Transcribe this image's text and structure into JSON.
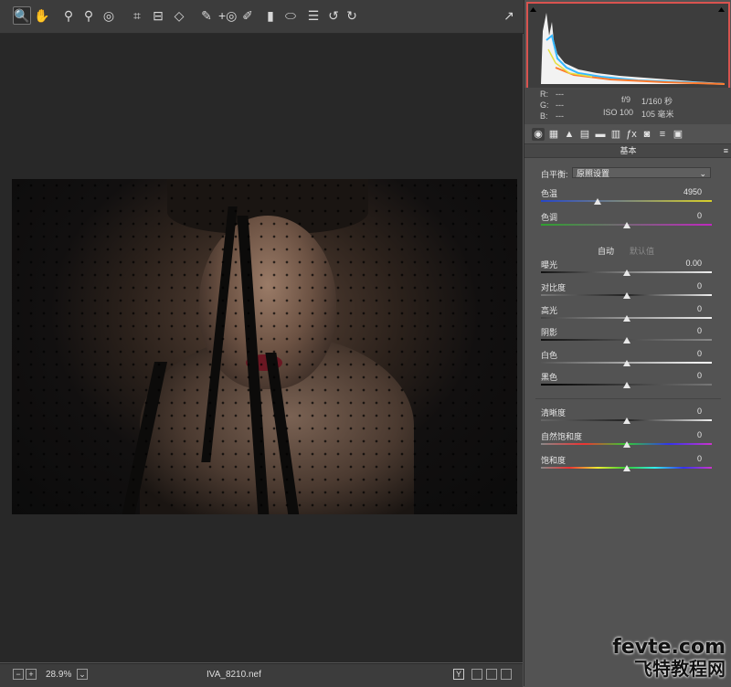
{
  "toolbar": {
    "tools": [
      {
        "icon": "zoom-icon",
        "glyph": "🔍"
      },
      {
        "icon": "hand-icon",
        "glyph": "✋"
      },
      {
        "icon": "white-balance-icon",
        "glyph": "⚲"
      },
      {
        "icon": "color-sampler-icon",
        "glyph": "⚲"
      },
      {
        "icon": "targeted-adjust-icon",
        "glyph": "◎"
      },
      {
        "icon": "crop-icon",
        "glyph": "⌗"
      },
      {
        "icon": "straighten-icon",
        "glyph": "⊟"
      },
      {
        "icon": "transform-icon",
        "glyph": "◇"
      },
      {
        "icon": "spot-removal-icon",
        "glyph": "✎"
      },
      {
        "icon": "red-eye-icon",
        "glyph": "+◎"
      },
      {
        "icon": "adjustment-brush-icon",
        "glyph": "✐"
      },
      {
        "icon": "graduated-filter-icon",
        "glyph": "▮"
      },
      {
        "icon": "radial-filter-icon",
        "glyph": "⬭"
      },
      {
        "icon": "preferences-icon",
        "glyph": "☰"
      },
      {
        "icon": "rotate-ccw-icon",
        "glyph": "↺"
      },
      {
        "icon": "rotate-cw-icon",
        "glyph": "↻"
      }
    ],
    "export_icon": "↗"
  },
  "status": {
    "zoom": "28.9%",
    "filename": "IVA_8210.nef",
    "minus": "−",
    "plus": "+",
    "dropdown": "⌄",
    "view_y": "Y"
  },
  "info": {
    "r_label": "R:",
    "r_value": "---",
    "g_label": "G:",
    "g_value": "---",
    "b_label": "B:",
    "b_value": "---",
    "aperture": "f/9",
    "shutter": "1/160 秒",
    "iso": "ISO 100",
    "focal": "105 毫米"
  },
  "panel": {
    "title": "基本",
    "wb_label": "白平衡:",
    "wb_value": "原照设置",
    "auto": "自动",
    "default": "默认值",
    "sliders": [
      {
        "label": "色温",
        "value": "4950",
        "pos": 0.33,
        "gradient": "linear-gradient(90deg,#2646c8,#d8d02a)"
      },
      {
        "label": "色调",
        "value": "0",
        "pos": 0.5,
        "gradient": "linear-gradient(90deg,#2fa02f,#c028c0)"
      },
      {
        "label": "曝光",
        "value": "0.00",
        "pos": 0.5,
        "gradient": "linear-gradient(90deg,#111,#eee)"
      },
      {
        "label": "对比度",
        "value": "0",
        "pos": 0.5,
        "gradient": "linear-gradient(90deg,#777,#222,#eee)"
      },
      {
        "label": "高光",
        "value": "0",
        "pos": 0.5,
        "gradient": "linear-gradient(90deg,#444,#eee)"
      },
      {
        "label": "阴影",
        "value": "0",
        "pos": 0.5,
        "gradient": "linear-gradient(90deg,#111,#888)"
      },
      {
        "label": "白色",
        "value": "0",
        "pos": 0.5,
        "gradient": "linear-gradient(90deg,#555,#fff)"
      },
      {
        "label": "黑色",
        "value": "0",
        "pos": 0.5,
        "gradient": "linear-gradient(90deg,#000,#777)"
      },
      {
        "label": "清晰度",
        "value": "0",
        "pos": 0.5,
        "gradient": "linear-gradient(90deg,#666,#222,#eee)"
      },
      {
        "label": "自然饱和度",
        "value": "0",
        "pos": 0.5,
        "gradient": "linear-gradient(90deg,#888,#e33,#3c3,#33e,#c3c)"
      },
      {
        "label": "饱和度",
        "value": "0",
        "pos": 0.5,
        "gradient": "linear-gradient(90deg,#888,#e33,#ee3,#3c3,#3ee,#33e,#c3c)"
      }
    ]
  },
  "panel_tabs": [
    {
      "icon": "basic-tab-icon",
      "glyph": "◉"
    },
    {
      "icon": "tone-curve-tab-icon",
      "glyph": "▦"
    },
    {
      "icon": "detail-tab-icon",
      "glyph": "▲"
    },
    {
      "icon": "hsl-tab-icon",
      "glyph": "▤"
    },
    {
      "icon": "split-toning-tab-icon",
      "glyph": "▬"
    },
    {
      "icon": "lens-tab-icon",
      "glyph": "▥"
    },
    {
      "icon": "effects-tab-icon",
      "glyph": "ƒx"
    },
    {
      "icon": "camera-calibration-tab-icon",
      "glyph": "◙"
    },
    {
      "icon": "presets-tab-icon",
      "glyph": "≡"
    },
    {
      "icon": "snapshots-tab-icon",
      "glyph": "▣"
    }
  ],
  "watermark": {
    "line1": "fevte.com",
    "line2": "飞特教程网"
  }
}
